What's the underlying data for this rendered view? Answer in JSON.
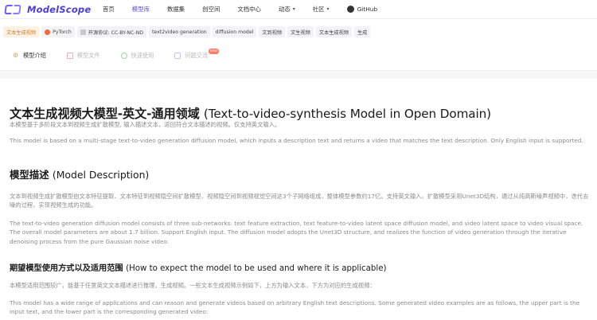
{
  "brand": {
    "name": "ModelScope"
  },
  "nav": {
    "items": [
      {
        "label": "首页",
        "active": false,
        "dropdown": false
      },
      {
        "label": "模型库",
        "active": true,
        "dropdown": false
      },
      {
        "label": "数据集",
        "active": false,
        "dropdown": false
      },
      {
        "label": "创空间",
        "active": false,
        "dropdown": false
      },
      {
        "label": "文档中心",
        "active": false,
        "dropdown": false
      },
      {
        "label": "动态",
        "active": false,
        "dropdown": true
      },
      {
        "label": "社区",
        "active": false,
        "dropdown": true
      },
      {
        "label": "GitHub",
        "active": false,
        "dropdown": false,
        "icon": "github-icon"
      }
    ]
  },
  "tags": [
    {
      "label": "文本生成视频",
      "kind": "task"
    },
    {
      "label": "PyTorch",
      "kind": "framework",
      "icon": "pytorch-icon"
    },
    {
      "label": "开源协议: CC-BY-NC-ND",
      "kind": "license",
      "icon": "license-icon"
    },
    {
      "label": "text2video generation",
      "kind": "plain"
    },
    {
      "label": "diffusion model",
      "kind": "plain"
    },
    {
      "label": "文到视频",
      "kind": "plain"
    },
    {
      "label": "文生视频",
      "kind": "plain"
    },
    {
      "label": "文本生成视频",
      "kind": "plain"
    },
    {
      "label": "生成",
      "kind": "plain"
    }
  ],
  "tabs": [
    {
      "label": "模型介绍",
      "active": true,
      "icon": "model-intro-icon"
    },
    {
      "label": "模型文件",
      "active": false,
      "icon": "model-files-icon"
    },
    {
      "label": "快速使用",
      "active": false,
      "icon": "quick-use-icon"
    },
    {
      "label": "问题交流",
      "active": false,
      "icon": "discussion-icon",
      "badge": "new"
    }
  ],
  "content": {
    "title_cn": "文本生成视频大模型-英文-通用领域 ",
    "title_en": "(Text-to-video-synthesis Model in Open Domain)",
    "intro_cn": "本模型基于多阶段文本到视频生成扩散模型, 输入描述文本，返回符合文本描述的视频。仅支持英文输入。",
    "intro_en": "This model is based on a multi-stage text-to-video generation diffusion model, which inputs a description text and returns a video that matches the text description. Only English input is supported.",
    "desc_title_cn": "模型描述 ",
    "desc_title_en": "(Model Description)",
    "desc_cn": "文本到视频生成扩散模型由文本特征提取、文本特征到视频隐空间扩散模型、视频隐空间到视频视觉空间这3个子网络组成，整体模型参数约17亿。支持英文输入。扩散模型采用Unet3D结构，通过从纯高斯噪声视频中，迭代去噪的过程，实现视频生成的功能。",
    "desc_en": "The text-to-video generation diffusion model consists of three sub-networks: text feature extraction, text feature-to-video latent space diffusion model, and video latent space to video visual space. The overall model parameters are about 1.7 billion. Support English input. The diffusion model adopts the Unet3D structure, and realizes the function of video generation through the iterative denoising process from the pure Gaussian noise video.",
    "usage_title_cn": "期望模型使用方式以及适用范围 ",
    "usage_title_en": "(How to expect the model to be used and where it is applicable)",
    "usage_cn": "本模型适用范围较广，能基于任意英文文本描述进行推理，生成视频。一些文本生成视频示例如下，上方为输入文本，下方为对应的生成视频：",
    "usage_en": "This model has a wide range of applications and can reason and generate videos based on arbitrary English text descriptions. Some generated video examples are as follows, the upper part is the input text, and the lower part is the corresponding generated video:"
  },
  "colors": {
    "accent": "#5b4ce6",
    "task_tag_bg": "#fdf1e3",
    "task_tag_text": "#c8822e"
  }
}
